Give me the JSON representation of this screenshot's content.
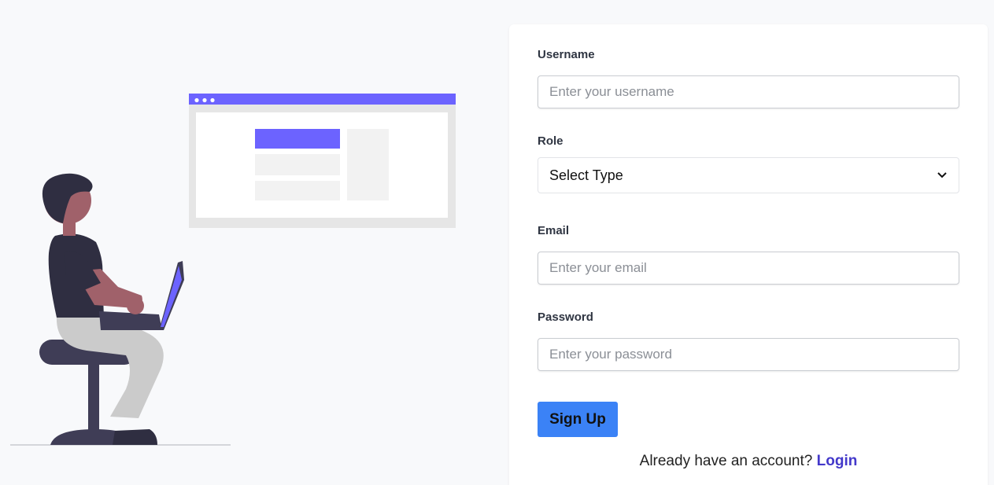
{
  "form": {
    "username_label": "Username",
    "username_placeholder": "Enter your username",
    "role_label": "Role",
    "role_selected": "Select Type",
    "email_label": "Email",
    "email_placeholder": "Enter your email",
    "password_label": "Password",
    "password_placeholder": "Enter your password",
    "submit_label": "Sign Up",
    "login_prompt": "Already have an account?",
    "login_link": "Login"
  },
  "icons": {
    "select_chevron": "chevron-down-icon"
  },
  "colors": {
    "accent": "#6c63ff",
    "button": "#3b82f6",
    "link": "#4338ca",
    "background": "#f8f9fb"
  }
}
